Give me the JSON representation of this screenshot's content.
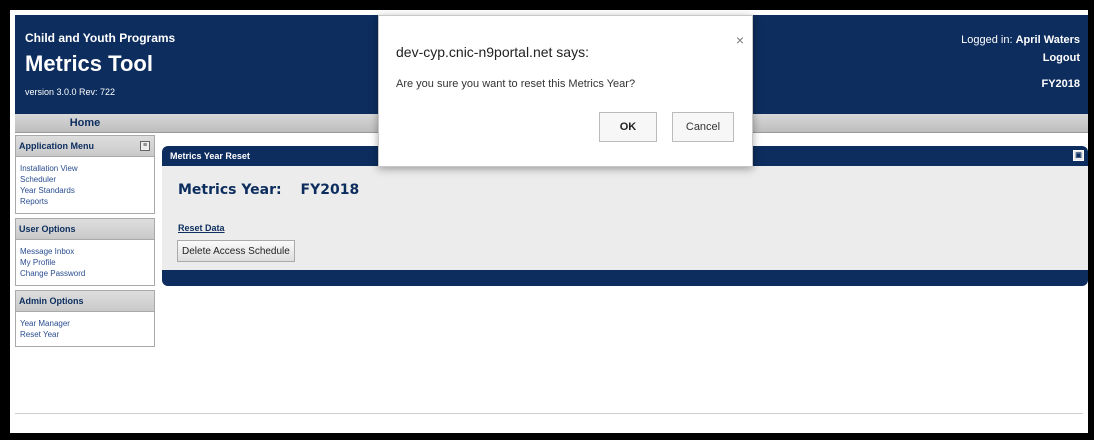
{
  "header": {
    "org": "Child and Youth Programs",
    "app_title": "Metrics Tool",
    "version": "version 3.0.0 Rev: 722",
    "logged_in_label": "Logged in:",
    "user_name": "April Waters",
    "logout": "Logout",
    "fiscal_year": "FY2018"
  },
  "nav": {
    "home": "Home"
  },
  "sidebar": {
    "app_menu": {
      "title": "Application Menu",
      "items": [
        "Installation View",
        "Scheduler",
        "Year Standards",
        "Reports"
      ]
    },
    "user_options": {
      "title": "User Options",
      "items": [
        "Message Inbox",
        "My Profile",
        "Change Password"
      ]
    },
    "admin_options": {
      "title": "Admin Options",
      "items": [
        "Year Manager",
        "Reset Year"
      ]
    }
  },
  "content": {
    "header_title": "Metrics Year Reset",
    "metrics_year_label": "Metrics Year:",
    "metrics_year_value": "FY2018",
    "reset_data_label": "Reset Data",
    "delete_button": "Delete Access Schedule"
  },
  "dialog": {
    "title": "dev-cyp.cnic-n9portal.net says:",
    "message": "Are you sure you want to reset this Metrics Year?",
    "ok": "OK",
    "cancel": "Cancel",
    "close": "×"
  },
  "colors": {
    "brand": "#0c2d5e",
    "link": "#2a4d8f"
  }
}
